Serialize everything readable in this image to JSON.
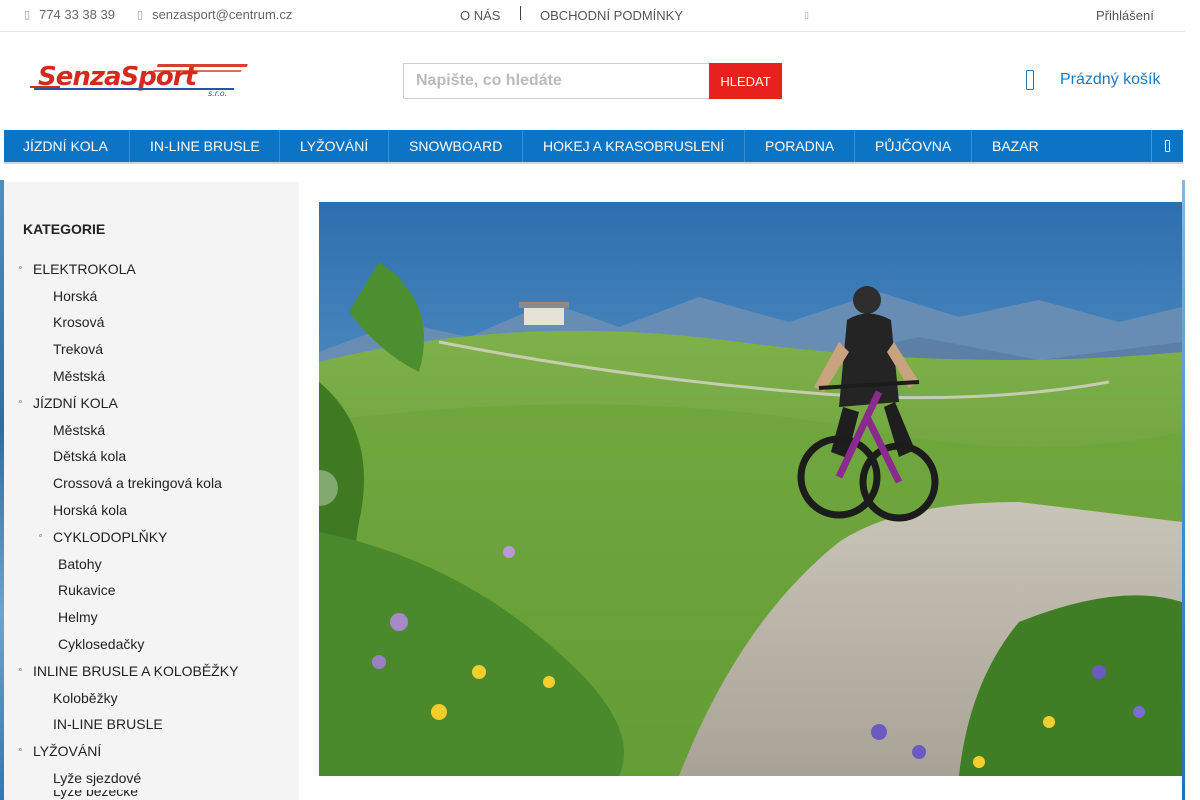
{
  "topbar": {
    "phone": "774 33 38 39",
    "email": "senzasport@centrum.cz",
    "about": "O NÁS",
    "terms": "OBCHODNÍ PODMÍNKY",
    "login": "Přihlášení"
  },
  "header": {
    "logo_text": "SenzaSport",
    "logo_suffix": "s.r.o.",
    "search_placeholder": "Napište, co hledáte",
    "search_button": "HLEDAT",
    "cart_label": "Prázdný košík"
  },
  "nav": {
    "items": [
      "JÍZDNÍ KOLA",
      "IN-LINE BRUSLE",
      "LYŽOVÁNÍ",
      "SNOWBOARD",
      "HOKEJ A KRASOBRUSLENÍ",
      "PORADNA",
      "PŮJČOVNA",
      "BAZAR"
    ]
  },
  "sidebar": {
    "heading": "KATEGORIE",
    "categories": [
      "ELEKTROKOLA",
      "Horská",
      "Krosová",
      "Treková",
      "Městská",
      "JÍZDNÍ KOLA",
      "Městská",
      "Dětská kola",
      "Crossová a trekingová kola",
      "Horská kola",
      "CYKLODOPLŇKY",
      "Batohy",
      "Rukavice",
      "Helmy",
      "Cyklosedačky",
      "INLINE BRUSLE A KOLOBĚŽKY",
      "Koloběžky",
      "IN-LINE BRUSLE",
      "LYŽOVÁNÍ",
      "Lyže sjezdové",
      "Lyže běžecké"
    ]
  },
  "colors": {
    "nav": "#0b74c4",
    "accent": "#e8201e",
    "link": "#1a78c2"
  },
  "icons": {
    "phone": "phone-icon",
    "email": "mail-icon",
    "language": "flag-icon",
    "cart": "cart-icon",
    "more": "menu-more-icon"
  }
}
